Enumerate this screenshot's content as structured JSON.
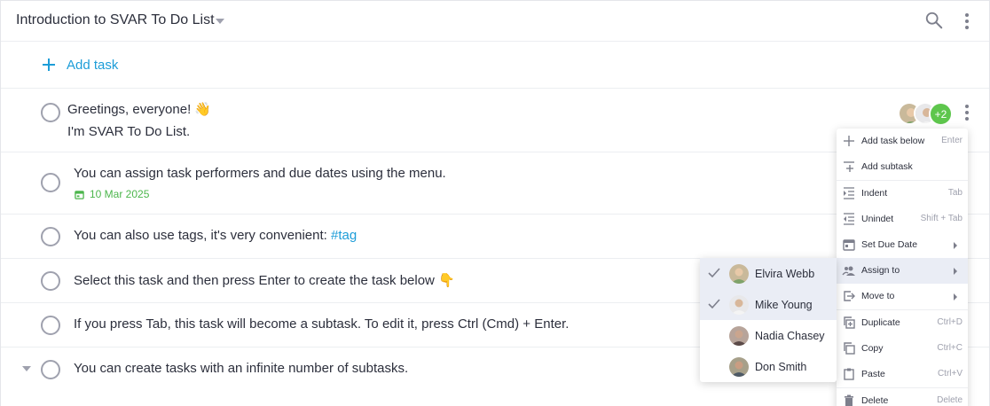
{
  "header": {
    "title": "Introduction to SVAR To Do List",
    "icons": [
      "search-icon",
      "more-vertical-icon",
      "chevron-down-icon"
    ]
  },
  "add_task": {
    "label": "Add task",
    "icon": "plus-icon"
  },
  "tasks": [
    {
      "line1": "Greetings, everyone! 👋",
      "line2": "I'm SVAR To Do List.",
      "assignees_more": "+2"
    },
    {
      "text": "You can assign task performers and due dates using the menu.",
      "due": "10 Mar 2025"
    },
    {
      "text_prefix": "You can also use tags, it's very convenient: ",
      "tag": "#tag"
    },
    {
      "text": "Select this task and then press Enter to create the task below 👇"
    },
    {
      "text": "If you press Tab, this task will become a subtask. To edit it, press Ctrl (Cmd) + Enter."
    },
    {
      "text": "You can create tasks with an infinite number of subtasks."
    }
  ],
  "context_menu": {
    "items": [
      {
        "label": "Add task below",
        "hotkey": "Enter",
        "icon": "plus-icon"
      },
      {
        "label": "Add subtask",
        "hotkey": "",
        "icon": "add-subtask-icon"
      },
      {
        "label": "Indent",
        "hotkey": "Tab",
        "icon": "indent-icon"
      },
      {
        "label": "Unindet",
        "hotkey": "Shift + Tab",
        "icon": "unindent-icon"
      },
      {
        "label": "Set Due Date",
        "hotkey": "",
        "icon": "calendar-icon",
        "submenu": true
      },
      {
        "label": "Assign to",
        "hotkey": "",
        "icon": "users-icon",
        "submenu": true,
        "active": true
      },
      {
        "label": "Move to",
        "hotkey": "",
        "icon": "move-to-icon",
        "submenu": true
      },
      {
        "label": "Duplicate",
        "hotkey": "Ctrl+D",
        "icon": "duplicate-icon"
      },
      {
        "label": "Copy",
        "hotkey": "Ctrl+C",
        "icon": "copy-icon"
      },
      {
        "label": "Paste",
        "hotkey": "Ctrl+V",
        "icon": "paste-icon"
      },
      {
        "label": "Delete",
        "hotkey": "Delete",
        "icon": "trash-icon"
      }
    ]
  },
  "assign_submenu": {
    "users": [
      {
        "name": "Elvira Webb",
        "checked": true
      },
      {
        "name": "Mike Young",
        "checked": true
      },
      {
        "name": "Nadia Chasey",
        "checked": false
      },
      {
        "name": "Don Smith",
        "checked": false
      }
    ]
  },
  "colors": {
    "accent": "#1d9dd8",
    "due_date": "#4cb64c",
    "badge": "#5ec64d",
    "active_row": "#eaedf5",
    "text": "#2c2f3c",
    "muted": "#9fa1ae"
  }
}
